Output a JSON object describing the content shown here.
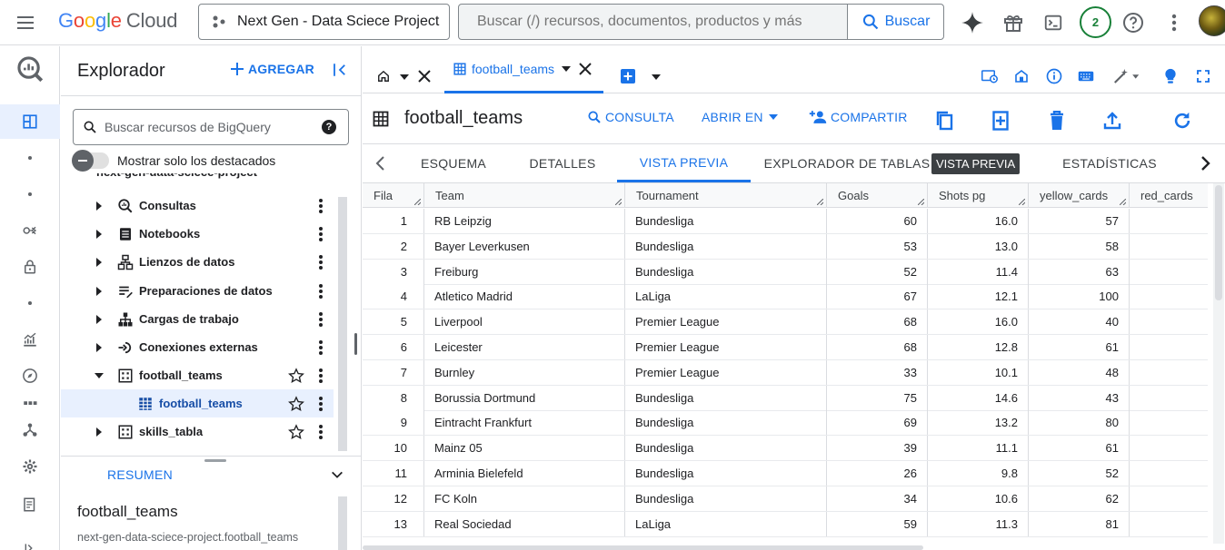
{
  "topbar": {
    "logo": {
      "g1": "G",
      "g2": "o",
      "g3": "o",
      "g4": "g",
      "g5": "l",
      "g6": "e",
      "cloud": "Cloud"
    },
    "project": "Next Gen - Data Sciece Project",
    "search_placeholder": "Buscar (/) recursos, documentos, productos y más",
    "search_button": "Buscar",
    "notification_count": "2",
    "icons": [
      "menu-icon",
      "gemini-sparkle-icon",
      "gift-icon",
      "cloud-shell-icon",
      "help-icon",
      "more-vert-icon"
    ]
  },
  "rail": {
    "items": [
      "bigquery-logo-icon",
      "dashboard-icon",
      "dot",
      "dot",
      "pipeline-icon",
      "lock-icon",
      "dot",
      "analytics-icon",
      "explore-icon",
      "grid-icon",
      "hub-icon",
      "settings-icon",
      "release-notes-icon",
      "expand-icon"
    ]
  },
  "explorer": {
    "title": "Explorador",
    "add_label": "AGREGAR",
    "search_placeholder": "Buscar recursos de BigQuery",
    "toggle_label": "Mostrar solo los destacados",
    "project_clipped": "next-gen-data-sciece-project",
    "tree": [
      {
        "label": "Consultas",
        "icon": "query-icon",
        "expanded": false
      },
      {
        "label": "Notebooks",
        "icon": "notebook-icon",
        "expanded": false
      },
      {
        "label": "Lienzos de datos",
        "icon": "canvas-icon",
        "expanded": false
      },
      {
        "label": "Preparaciones de datos",
        "icon": "data-prep-icon",
        "expanded": false
      },
      {
        "label": "Cargas de trabajo",
        "icon": "workload-icon",
        "expanded": false
      },
      {
        "label": "Conexiones externas",
        "icon": "connection-icon",
        "expanded": false
      },
      {
        "label": "football_teams",
        "icon": "dataset-icon",
        "expanded": true
      },
      {
        "label": "football_teams",
        "icon": "table-icon",
        "child": true
      },
      {
        "label": "skills_tabla",
        "icon": "dataset-icon",
        "expanded": false
      }
    ],
    "summary": {
      "tab": "RESUMEN",
      "title": "football_teams",
      "path": "next-gen-data-sciece-project.football_teams"
    }
  },
  "main": {
    "tab_label": "football_teams",
    "table_title": "football_teams",
    "actions": {
      "query": "CONSULTA",
      "open_in": "ABRIR EN",
      "share": "COMPARTIR"
    },
    "subtabs": [
      "ESQUEMA",
      "DETALLES",
      "VISTA PREVIA",
      "EXPLORADOR DE TABLAS",
      "ESTADÍSTICAS"
    ],
    "tooltip": "VISTA PREVIA",
    "columns": [
      "Fila",
      "Team",
      "Tournament",
      "Goals",
      "Shots pg",
      "yellow_cards",
      "red_cards"
    ],
    "rows": [
      {
        "n": "1",
        "team": "RB Leipzig",
        "tournament": "Bundesliga",
        "goals": "60",
        "shots": "16.0",
        "yellow": "57"
      },
      {
        "n": "2",
        "team": "Bayer Leverkusen",
        "tournament": "Bundesliga",
        "goals": "53",
        "shots": "13.0",
        "yellow": "58"
      },
      {
        "n": "3",
        "team": "Freiburg",
        "tournament": "Bundesliga",
        "goals": "52",
        "shots": "11.4",
        "yellow": "63"
      },
      {
        "n": "4",
        "team": "Atletico Madrid",
        "tournament": "LaLiga",
        "goals": "67",
        "shots": "12.1",
        "yellow": "100"
      },
      {
        "n": "5",
        "team": "Liverpool",
        "tournament": "Premier League",
        "goals": "68",
        "shots": "16.0",
        "yellow": "40"
      },
      {
        "n": "6",
        "team": "Leicester",
        "tournament": "Premier League",
        "goals": "68",
        "shots": "12.8",
        "yellow": "61"
      },
      {
        "n": "7",
        "team": "Burnley",
        "tournament": "Premier League",
        "goals": "33",
        "shots": "10.1",
        "yellow": "48"
      },
      {
        "n": "8",
        "team": "Borussia Dortmund",
        "tournament": "Bundesliga",
        "goals": "75",
        "shots": "14.6",
        "yellow": "43"
      },
      {
        "n": "9",
        "team": "Eintracht Frankfurt",
        "tournament": "Bundesliga",
        "goals": "69",
        "shots": "13.2",
        "yellow": "80"
      },
      {
        "n": "10",
        "team": "Mainz 05",
        "tournament": "Bundesliga",
        "goals": "39",
        "shots": "11.1",
        "yellow": "61"
      },
      {
        "n": "11",
        "team": "Arminia Bielefeld",
        "tournament": "Bundesliga",
        "goals": "26",
        "shots": "9.8",
        "yellow": "52"
      },
      {
        "n": "12",
        "team": "FC Koln",
        "tournament": "Bundesliga",
        "goals": "34",
        "shots": "10.6",
        "yellow": "62"
      },
      {
        "n": "13",
        "team": "Real Sociedad",
        "tournament": "LaLiga",
        "goals": "59",
        "shots": "11.3",
        "yellow": "81"
      }
    ]
  },
  "colors": {
    "accent": "#1a73e8",
    "text": "#202124",
    "border": "#dadce0",
    "selected_bg": "#e8f0fe",
    "badge_green": "#188038"
  }
}
